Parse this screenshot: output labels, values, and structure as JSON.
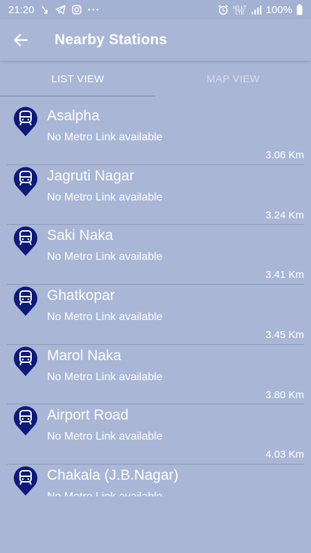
{
  "status_bar": {
    "time": "21:20",
    "volte_label": "Vo)) LTE",
    "battery": "100%",
    "left_icons": [
      "missed-call-icon",
      "telegram-icon",
      "instagram-icon",
      "more-dots-icon"
    ],
    "right_icons": [
      "alarm-icon",
      "volte-icon",
      "signal-icon",
      "battery-icon"
    ]
  },
  "app_bar": {
    "title": "Nearby Stations",
    "back_icon": "arrow-back-icon"
  },
  "tabs": [
    {
      "label": "LIST VIEW",
      "active": true
    },
    {
      "label": "MAP VIEW",
      "active": false
    }
  ],
  "stations": [
    {
      "name": "Asalpha",
      "link": "No Metro Link available",
      "distance": "3.06 Km"
    },
    {
      "name": "Jagruti Nagar",
      "link": "No Metro Link available",
      "distance": "3.24 Km"
    },
    {
      "name": "Saki Naka",
      "link": "No Metro Link available",
      "distance": "3.41 Km"
    },
    {
      "name": "Ghatkopar",
      "link": "No Metro Link available",
      "distance": "3.45 Km"
    },
    {
      "name": "Marol Naka",
      "link": "No Metro Link available",
      "distance": "3.80 Km"
    },
    {
      "name": "Airport Road",
      "link": "No Metro Link available",
      "distance": "4.03 Km"
    },
    {
      "name": "Chakala (J.B.Nagar)",
      "link": "No Metro Link available",
      "distance": ""
    }
  ],
  "colors": {
    "background": "#a9b6d6",
    "pin": "#0d1a7a",
    "text": "#ffffff"
  }
}
